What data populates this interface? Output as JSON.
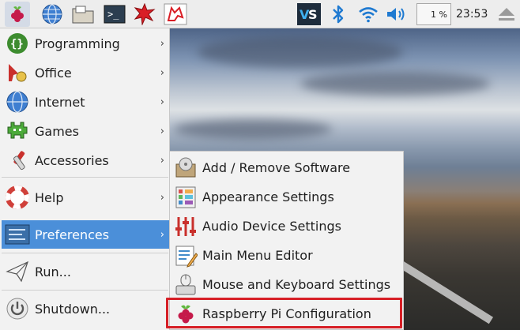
{
  "panel": {
    "icons": [
      "raspberry-menu-icon",
      "web-browser-icon",
      "file-manager-icon",
      "terminal-icon",
      "mathematica-icon",
      "wolfram-icon"
    ],
    "tray_icons": [
      "vnc-icon",
      "bluetooth-icon",
      "wifi-icon",
      "volume-icon"
    ],
    "cpu_usage": "1 %",
    "clock": "23:53",
    "eject_icon": "eject-icon"
  },
  "main_menu": {
    "items": [
      {
        "label": "Programming",
        "icon": "programming-icon"
      },
      {
        "label": "Office",
        "icon": "office-icon"
      },
      {
        "label": "Internet",
        "icon": "internet-icon"
      },
      {
        "label": "Games",
        "icon": "games-icon"
      },
      {
        "label": "Accessories",
        "icon": "accessories-icon"
      },
      {
        "label": "Help",
        "icon": "help-icon"
      },
      {
        "label": "Preferences",
        "icon": "preferences-icon"
      },
      {
        "label": "Run...",
        "icon": "run-icon"
      },
      {
        "label": "Shutdown...",
        "icon": "shutdown-icon"
      }
    ],
    "arrow": "›"
  },
  "preferences_submenu": {
    "items": [
      {
        "label": "Add / Remove Software",
        "icon": "software-icon"
      },
      {
        "label": "Appearance Settings",
        "icon": "appearance-icon"
      },
      {
        "label": "Audio Device Settings",
        "icon": "audio-icon"
      },
      {
        "label": "Main Menu Editor",
        "icon": "menu-editor-icon"
      },
      {
        "label": "Mouse and Keyboard Settings",
        "icon": "mouse-keyboard-icon"
      },
      {
        "label": "Raspberry Pi Configuration",
        "icon": "raspberry-config-icon"
      }
    ]
  },
  "colors": {
    "highlight": "#4b8fd9",
    "annotation_box": "#d61f26"
  }
}
